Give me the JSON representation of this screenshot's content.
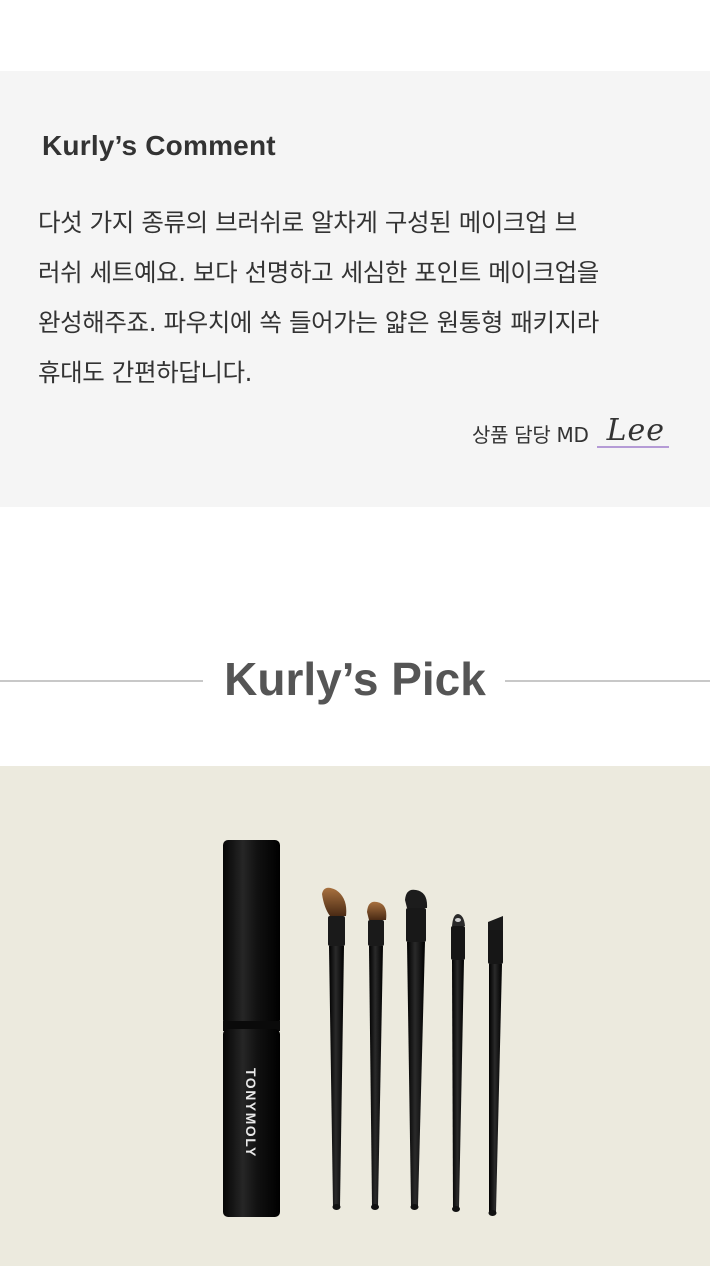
{
  "comment": {
    "title": "Kurly’s Comment",
    "lines": [
      "다섯 가지 종류의 브러쉬로 알차게 구성된 메이크업 브",
      "러쉬 세트예요. 보다 선명하고 세심한 포인트 메이크업을",
      "완성해주죠. 파우치에 쏙 들어가는 얇은 원통형 패키지라",
      "휴대도 간편하답니다."
    ],
    "md_label": "상품 담당 MD",
    "md_name": "Lee"
  },
  "pick": {
    "title": "Kurly’s Pick"
  },
  "photo": {
    "brand_text": "TONYMOLY",
    "background_color": "#eceade",
    "case_color": "#141414"
  }
}
